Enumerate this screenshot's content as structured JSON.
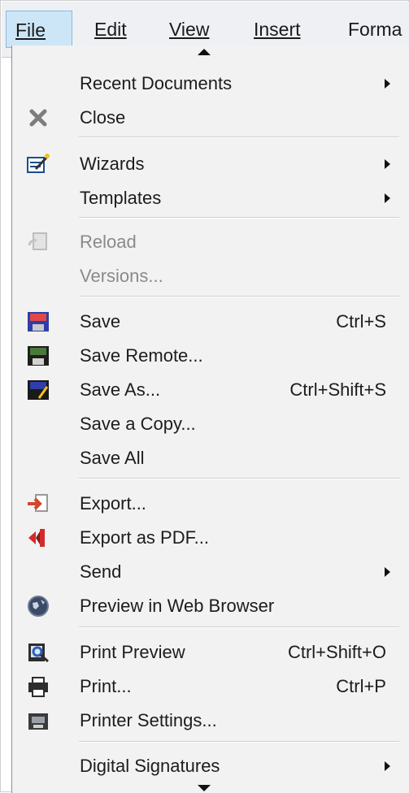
{
  "menubar": {
    "items": [
      "File",
      "Edit",
      "View",
      "Insert",
      "Forma"
    ]
  },
  "menu": {
    "recent_documents": "Recent Documents",
    "close": "Close",
    "wizards": "Wizards",
    "templates": "Templates",
    "reload": "Reload",
    "versions": "Versions...",
    "save": "Save",
    "save_shortcut": "Ctrl+S",
    "save_remote": "Save Remote...",
    "save_as": "Save As...",
    "save_as_shortcut": "Ctrl+Shift+S",
    "save_a_copy": "Save a Copy...",
    "save_all": "Save All",
    "export": "Export...",
    "export_pdf": "Export as PDF...",
    "send": "Send",
    "preview_web": "Preview in Web Browser",
    "print_preview": "Print Preview",
    "print_preview_shortcut": "Ctrl+Shift+O",
    "print": "Print...",
    "print_shortcut": "Ctrl+P",
    "printer_settings": "Printer Settings...",
    "digital_signatures": "Digital Signatures"
  },
  "icons": {
    "close": "close-icon",
    "wizards": "wizard-icon",
    "reload": "reload-icon",
    "save": "save-icon",
    "save_remote": "save-remote-icon",
    "save_as": "save-as-icon",
    "export": "export-icon",
    "export_pdf": "pdf-icon",
    "preview_web": "web-browser-icon",
    "print_preview": "print-preview-icon",
    "print": "printer-icon",
    "printer_settings": "printer-settings-icon"
  },
  "colors": {
    "menu_bg": "#f2f2f2",
    "menubar_bg": "#eef0f3",
    "active_bg": "#cde6f7",
    "disabled_text": "#8a8a8a"
  }
}
